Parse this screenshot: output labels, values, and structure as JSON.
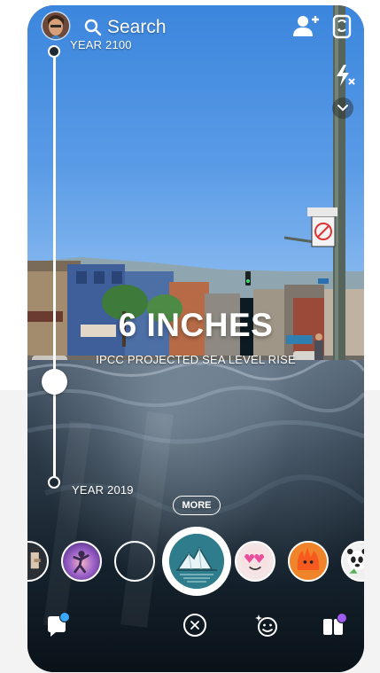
{
  "colors": {
    "sky_top": "#3b86dd",
    "water_dark": "#15222d",
    "white": "#ffffff",
    "chat_badge": "#3aa7ff",
    "stories_badge": "#a05cf0",
    "lens_active_bg": "#2f7c8c"
  },
  "top_bar": {
    "avatar_icon": "bitmoji-avatar-icon",
    "search_icon": "search-icon",
    "search_label": "Search",
    "add_friend_icon": "add-friend-icon",
    "flip_camera_icon": "flip-camera-icon",
    "flash_icon": "flash-off-icon",
    "more_options_icon": "chevron-down-icon"
  },
  "sea_level_lens": {
    "year_max": "YEAR 2100",
    "year_min": "YEAR 2019",
    "selected_fraction_from_2019": 0.23,
    "headline": "6 INCHES",
    "subline": "IPCC PROJECTED SEA LEVEL RISE",
    "more_label": "MORE"
  },
  "lens_carousel": [
    {
      "name": "lens-partial",
      "icon": "lens-thumbnail-icon"
    },
    {
      "name": "lens-dancer",
      "icon": "dancer-lens-icon"
    },
    {
      "name": "lens-empty",
      "icon": "empty-lens-icon"
    },
    {
      "name": "lens-iceberg",
      "icon": "iceberg-lens-icon",
      "active": true
    },
    {
      "name": "lens-heart-eyes",
      "icon": "heart-eyes-lens-icon"
    },
    {
      "name": "lens-fire-creature",
      "icon": "fire-creature-lens-icon"
    },
    {
      "name": "lens-panda",
      "icon": "panda-lens-icon"
    }
  ],
  "bottom_bar": {
    "chat_icon": "chat-icon",
    "close_icon": "close-lens-icon",
    "lens_explorer_icon": "lens-explorer-icon",
    "stories_icon": "stories-icon"
  }
}
